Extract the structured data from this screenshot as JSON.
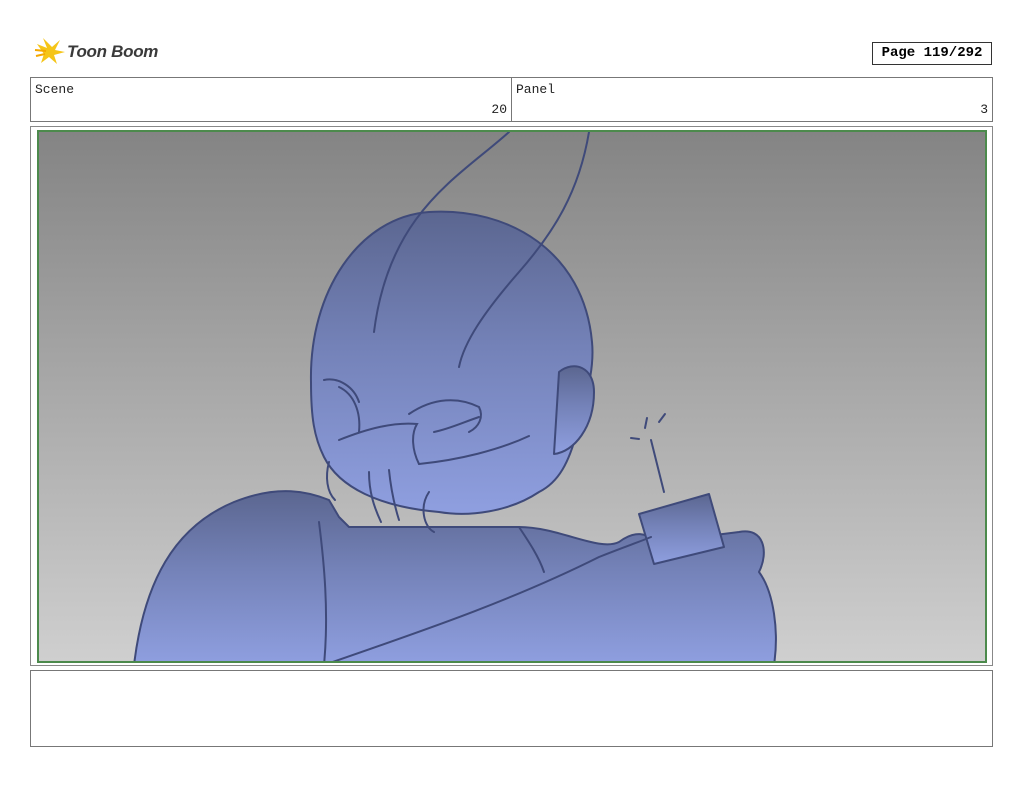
{
  "brand": {
    "name": "Toon Boom",
    "icon": "toon-boom-logo"
  },
  "page": {
    "label": "Page 119/292"
  },
  "header": {
    "scene_label": "Scene",
    "scene_value": "20",
    "panel_label": "Panel",
    "panel_value": "3"
  },
  "panel_image": {
    "icon": "storyboard-sketch-bald-figure-raising-cup"
  },
  "caption": {
    "text": ""
  },
  "colors": {
    "frame_border": "#4c8a4c",
    "sketch_fill": "#7f8cc8",
    "sketch_line": "#3f4a7a"
  }
}
